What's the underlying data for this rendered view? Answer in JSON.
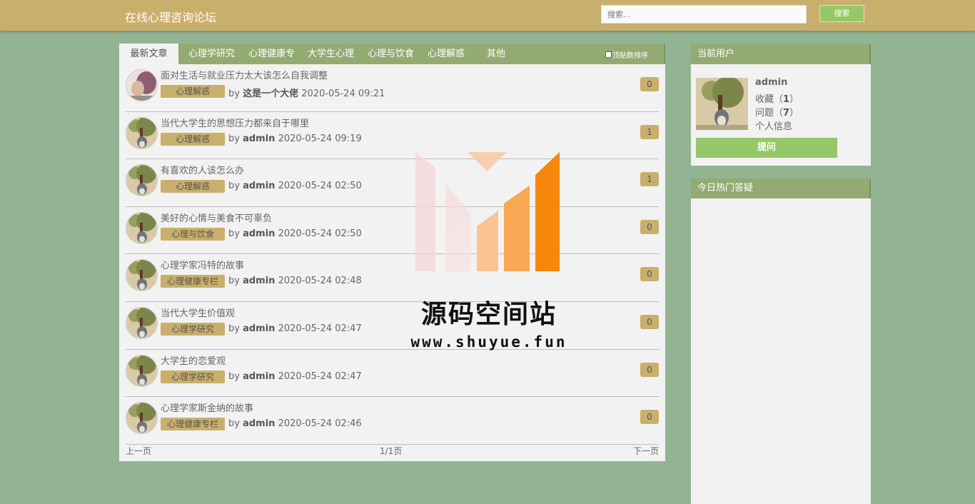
{
  "header": {
    "title": "在线心理咨询论坛",
    "search_placeholder": "搜索...",
    "search_button": "搜索"
  },
  "tabs": [
    {
      "label": "最新文章",
      "active": true
    },
    {
      "label": "心理学研究"
    },
    {
      "label": "心理健康专"
    },
    {
      "label": "大学生心理"
    },
    {
      "label": "心理与饮食"
    },
    {
      "label": "心理解惑"
    },
    {
      "label": "其他"
    }
  ],
  "sort_option": "顶贴数排序",
  "articles": [
    {
      "title": "面对生活与就业压力太大该怎么自我调整",
      "category": "心理解惑",
      "by": "by",
      "author": "这是一个大佬",
      "time": "2020-05-24 09:21",
      "count": "0"
    },
    {
      "title": "当代大学生的思想压力都来自于哪里",
      "category": "心理解惑",
      "by": "by",
      "author": "admin",
      "time": "2020-05-24 09:19",
      "count": "1"
    },
    {
      "title": "有喜欢的人该怎么办",
      "category": "心理解惑",
      "by": "by",
      "author": "admin",
      "time": "2020-05-24 02:50",
      "count": "1"
    },
    {
      "title": "美好的心情与美食不可辜负",
      "category": "心理与饮食",
      "by": "by",
      "author": "admin",
      "time": "2020-05-24 02:50",
      "count": "0"
    },
    {
      "title": "心理学家冯特的故事",
      "category": "心理健康专栏",
      "by": "by",
      "author": "admin",
      "time": "2020-05-24 02:48",
      "count": "0"
    },
    {
      "title": "当代大学生价值观",
      "category": "心理学研究",
      "by": "by",
      "author": "admin",
      "time": "2020-05-24 02:47",
      "count": "0"
    },
    {
      "title": "大学生的恋爱观",
      "category": "心理学研究",
      "by": "by",
      "author": "admin",
      "time": "2020-05-24 02:47",
      "count": "0"
    },
    {
      "title": "心理学家斯金纳的故事",
      "category": "心理健康专栏",
      "by": "by",
      "author": "admin",
      "time": "2020-05-24 02:46",
      "count": "0"
    }
  ],
  "pager": {
    "prev": "上一页",
    "info": "1/1页",
    "next": "下一页"
  },
  "user_panel": {
    "heading": "当前用户",
    "username": "admin",
    "favorites_label": "收藏（",
    "favorites_count": "1",
    "questions_label": "问题（",
    "questions_count": "7",
    "close_paren": "）",
    "profile_link": "个人信息",
    "ask_button": "提问"
  },
  "hot_panel": {
    "heading": "今日热门答疑"
  },
  "watermark": {
    "title": "源码空间站",
    "url": "www.shuyue.fun"
  }
}
